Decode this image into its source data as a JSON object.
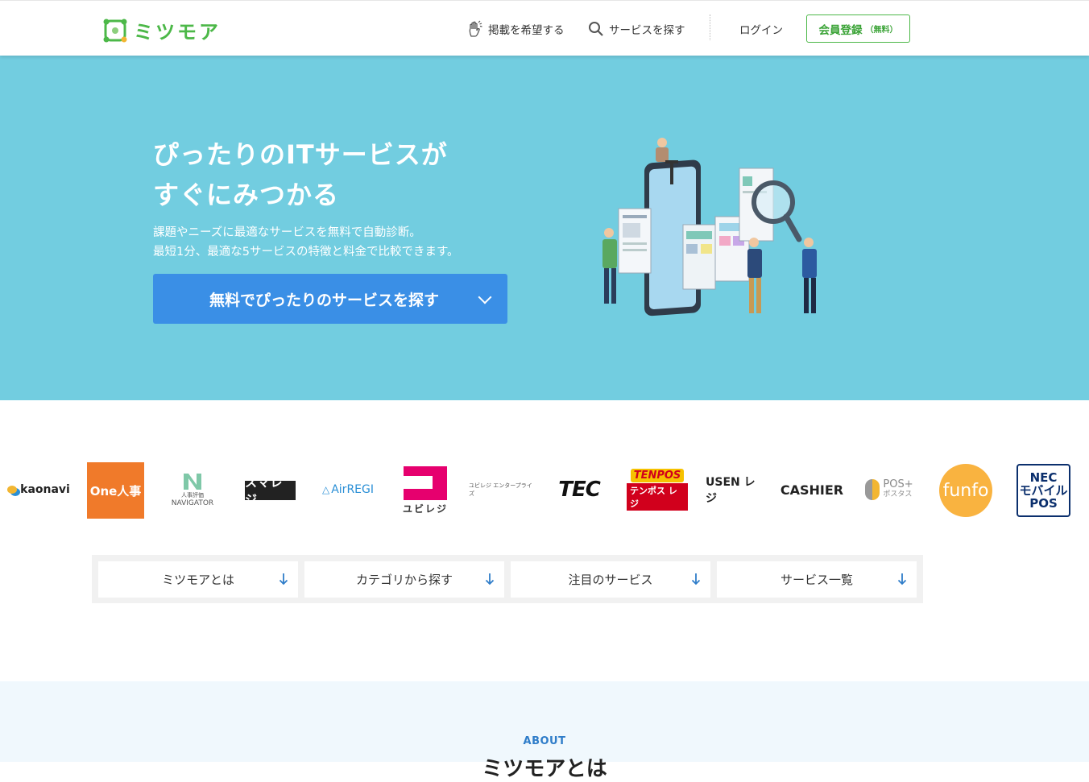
{
  "header": {
    "logo_text": "ミツモア",
    "nav_post_label": "掲載を希望する",
    "nav_search_label": "サービスを探す",
    "login_label": "ログイン",
    "register_label": "会員登録",
    "register_note": "（無料）",
    "accent_color": "#4cb848"
  },
  "hero": {
    "title_line1": "ぴったりのITサービスが",
    "title_line2": "すぐにみつかる",
    "sub_line1": "課題やニーズに最適なサービスを無料で自動診断。",
    "sub_line2": "最短1分、最適な5サービスの特徴と料金で比較できます。",
    "cta_label": "無料でぴったりのサービスを探す",
    "bg_color": "#72cde0",
    "cta_color": "#3a8fe6"
  },
  "logos": {
    "kaonavi": "kaonavi",
    "one": "One人事",
    "navi_top": "人事評価",
    "navi_bottom": "NAVIGATOR",
    "smaregi": "スマレジ",
    "airregi": "AirREGI",
    "ubiregi": "ユビレジ",
    "ubi_ent": "ユビレジ エンタープライズ",
    "tec": "TEC",
    "tenpos_top": "TENPOS",
    "tenpos_bottom": "テンポス レジ",
    "usen": "USEN レジ",
    "cashier": "CASHIER",
    "pos_top": "POS+",
    "pos_bottom": "ポスタス",
    "funfo": "funfo",
    "nec_1": "NEC",
    "nec_2": "モバイル",
    "nec_3": "POS"
  },
  "tabs": [
    {
      "label": "ミツモアとは"
    },
    {
      "label": "カテゴリから探す"
    },
    {
      "label": "注目のサービス"
    },
    {
      "label": "サービス一覧"
    }
  ],
  "about": {
    "label": "ABOUT",
    "title": "ミツモアとは"
  }
}
